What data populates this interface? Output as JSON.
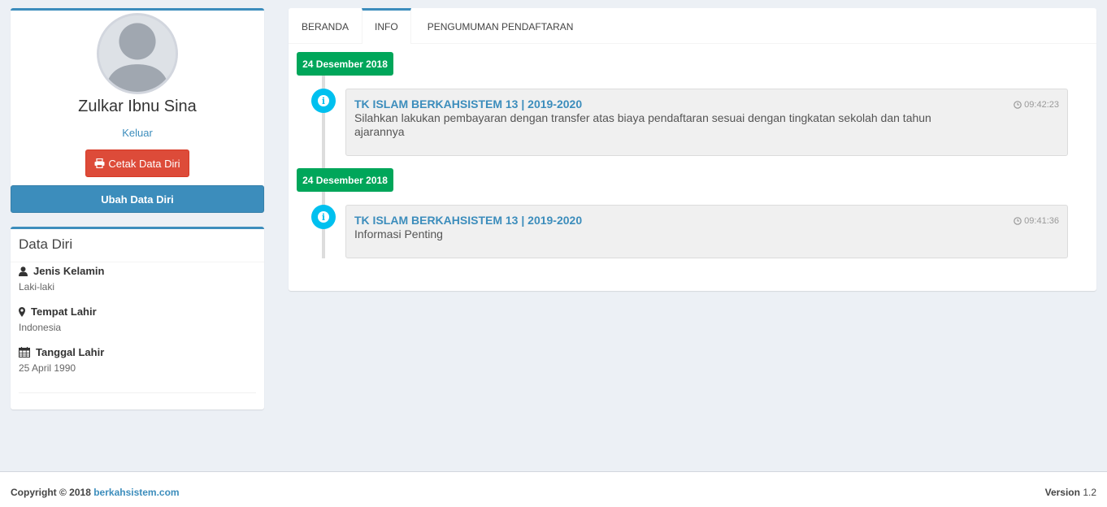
{
  "profile": {
    "name": "Zulkar Ibnu Sina",
    "logout_label": "Keluar",
    "print_button_label": "Cetak Data Diri",
    "edit_button_label": "Ubah Data Diri"
  },
  "data_diri": {
    "title": "Data Diri",
    "items": [
      {
        "icon": "user-icon",
        "label": "Jenis Kelamin",
        "value": "Laki-laki"
      },
      {
        "icon": "map-marker-icon",
        "label": "Tempat Lahir",
        "value": "Indonesia"
      },
      {
        "icon": "calendar-icon",
        "label": "Tanggal Lahir",
        "value": "25 April 1990"
      }
    ]
  },
  "tabs": [
    {
      "label": "BERANDA",
      "active": false
    },
    {
      "label": "INFO",
      "active": true
    },
    {
      "label": "PENGUMUMAN PENDAFTARAN",
      "active": false
    }
  ],
  "timeline": [
    {
      "date": "24 Desember 2018",
      "title": "TK ISLAM BERKAHSISTEM 13 | 2019-2020",
      "time": "09:42:23",
      "body": "Silahkan lakukan pembayaran dengan transfer atas biaya pendaftaran sesuai dengan tingkatan sekolah dan tahun ajarannya"
    },
    {
      "date": "24 Desember 2018",
      "title": "TK ISLAM BERKAHSISTEM 13 | 2019-2020",
      "time": "09:41:36",
      "body": "Informasi Penting"
    }
  ],
  "footer": {
    "copyright": "Copyright © 2018",
    "site_link": "berkahsistem.com",
    "version_label": "Version",
    "version": "1.2"
  },
  "colors": {
    "primary": "#3c8dbc",
    "danger": "#dd4b39",
    "success": "#00a65a",
    "info": "#00c0ef",
    "background": "#ecf0f5"
  }
}
